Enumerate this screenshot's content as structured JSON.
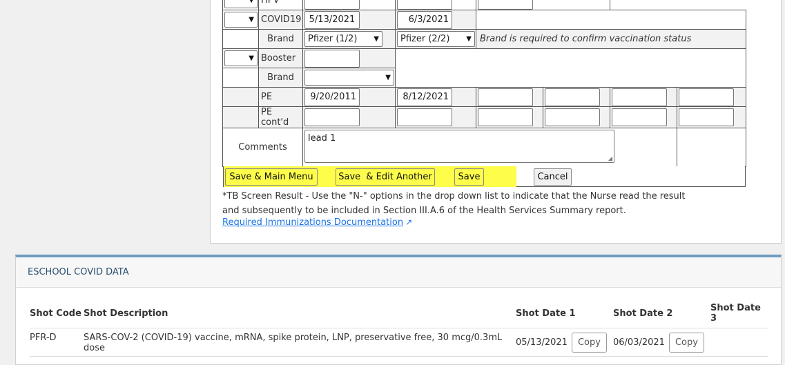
{
  "immunizations": {
    "hpv": {
      "label": "HPV"
    },
    "covid": {
      "label": "COVID19",
      "date1": "5/13/2021",
      "date2": "6/3/2021",
      "brand_label": "Brand",
      "brand1": "Pfizer (1/2)",
      "brand2": "Pfizer (2/2)",
      "brand_note": "Brand is required to confirm vaccination status"
    },
    "booster": {
      "label": "Booster",
      "date1": "",
      "brand_label": "Brand",
      "brand": ""
    },
    "pe": {
      "label": "PE",
      "date1": "9/20/2011",
      "date2": "8/12/2021"
    },
    "pe_contd": {
      "label": "PE cont'd"
    },
    "comments": {
      "label": "Comments",
      "value": "lead 1"
    }
  },
  "buttons": {
    "save_main": "Save & Main Menu",
    "save_edit": "Save  & Edit Another",
    "save": "Save",
    "cancel": "Cancel"
  },
  "help": {
    "tb_note": "*TB Screen Result - Use the \"N-\" options in the drop down list to indicate that the Nurse read the result and subsequently to be included in Section III.A.6 of the Health Services Summary report.",
    "doc_link": "Required Immunizations Documentation"
  },
  "covid_data": {
    "title": "ESCHOOL COVID DATA",
    "columns": [
      "Shot Code",
      "Shot Description",
      "Shot Date 1",
      "Shot Date 2",
      "Shot Date 3"
    ],
    "rows": [
      {
        "code": "PFR-D",
        "description": "SARS-COV-2 (COVID-19) vaccine, mRNA, spike protein, LNP, preservative free, 30 mcg/0.3mL dose",
        "date1": "05/13/2021",
        "date2": "06/03/2021",
        "copy_label": "Copy"
      }
    ]
  },
  "icons": {
    "dropdown": "chevron-down-icon",
    "external": "external-link-icon"
  }
}
